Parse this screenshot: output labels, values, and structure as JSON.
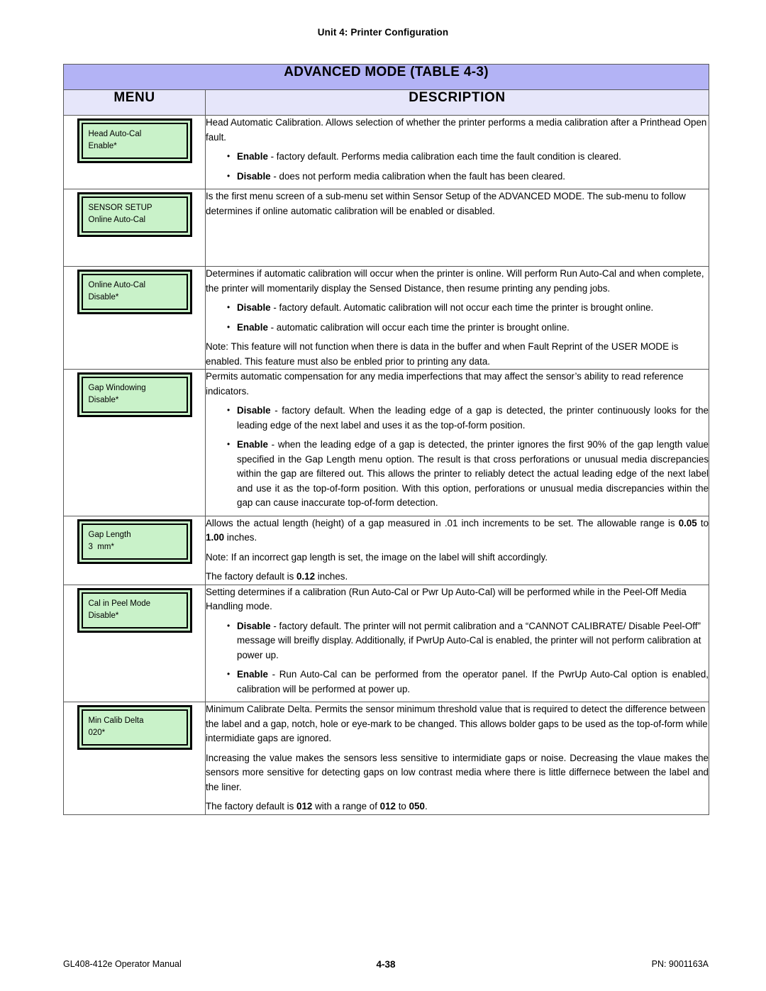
{
  "running_head": "Unit 4:  Printer Configuration",
  "table": {
    "title": "ADVANCED MODE (TABLE 4-3)",
    "col_menu_header": "MENU",
    "col_desc_header": "DESCRIPTION",
    "title_bg": "#b3b3f5",
    "header_bg": "#e6e6fa",
    "lcd_bg": "#c9f2c9",
    "rows": [
      {
        "lcd_line1": "Head Auto-Cal",
        "lcd_line2": "Enable*",
        "p1": "Head Automatic Calibration. Allows selection of whether the printer performs a media calibration after a Printhead Open fault.",
        "b1_label": "Enable",
        "b1_text": " - factory default. Performs media calibration each time the fault condition is cleared.",
        "b2_label": "Disable",
        "b2_text": " - does not perform media calibration when the fault has been cleared."
      },
      {
        "lcd_line1": "SENSOR SETUP",
        "lcd_line2": "Online Auto-Cal",
        "p1": "Is the first menu screen of a sub-menu set within Sensor Setup of the ADVANCED MODE. The sub-menu to follow determines if online automatic calibration will be enabled or disabled."
      },
      {
        "lcd_line1": "Online Auto-Cal",
        "lcd_line2": "Disable*",
        "p1": "Determines if automatic calibration will occur when the printer is online. Will perform Run Auto-Cal and when complete, the printer will momentarily display the Sensed Distance, then resume printing any pending jobs.",
        "b1_label": "Disable",
        "b1_text": " - factory default. Automatic calibration will not occur each time the printer is brought online.",
        "b2_label": "Enable",
        "b2_text": " - automatic calibration will occur each time the printer is brought online.",
        "p2": "Note: This feature will not function when there is data in the buffer and when Fault Reprint of the USER MODE is enabled. This feature must also be enbled prior to printing any data."
      },
      {
        "lcd_line1": "Gap Windowing",
        "lcd_line2": "Disable*",
        "p1": "Permits automatic compensation for any media imperfections that may affect the sensor’s ability to read reference indicators.",
        "b1_label": "Disable",
        "b1_text": " - factory default. When the leading edge of a gap is detected, the printer continuously looks for the leading edge of the next label and uses it as the top-of-form position.",
        "b2_label": "Enable",
        "b2_text": " - when the leading edge of a gap is detected, the printer ignores the first 90% of the gap length value specified in the Gap Length menu option. The result is that cross perforations or unusual media discrepancies within the gap are filtered out. This allows the printer to reliably detect the actual leading edge of the next label and use it as the top-of-form position. With this option, perforations or unusual media discrepancies within the gap can cause inaccurate top-of-form detection."
      },
      {
        "lcd_line1": "Gap Length",
        "lcd_line2": "3  mm*",
        "p1_a": "Allows the actual length (height) of a gap measured in .01 inch increments to be set. The allowable range is ",
        "p1_b1": "0.05",
        "p1_mid": " to ",
        "p1_b2": "1.00",
        "p1_c": " inches.",
        "p2": "Note: If an incorrect gap length is set, the image on the label will shift accordingly.",
        "p3_a": "The factory default is ",
        "p3_b": "0.12",
        "p3_c": " inches."
      },
      {
        "lcd_line1": "Cal in Peel Mode",
        "lcd_line2": "Disable*",
        "p1": "Setting determines if a calibration (Run Auto-Cal or Pwr Up Auto-Cal) will be performed while in the Peel-Off Media Handling mode.",
        "b1_label": "Disable",
        "b1_text": " - factory default. The printer will not permit calibration and a “CANNOT CALIBRATE/ Disable Peel-Off” message will breifly display. Additionally, if PwrUp Auto-Cal is enabled, the printer will not perform calibration at power up.",
        "b2_label": "Enable",
        "b2_text": " - Run Auto-Cal can be performed from the operator panel. If the PwrUp Auto-Cal option is enabled, calibration will be performed at power up."
      },
      {
        "lcd_line1": "Min Calib Delta",
        "lcd_line2": "020*",
        "p1": "Minimum Calibrate Delta. Permits the sensor minimum threshold value that is required to detect the difference  between the label and a gap, notch, hole or eye-mark to be changed. This allows bolder gaps to be used as the top-of-form while intermidiate gaps are ignored.",
        "p2": "Increasing the value makes the sensors less sensitive to intermidiate gaps or noise. Decreasing the vlaue makes the sensors more sensitive for  detecting gaps on low contrast media where there is little differnece between the label and the liner.",
        "p3_a": "The factory default is ",
        "p3_b1": "012",
        "p3_mid": " with a range of ",
        "p3_b2": "012",
        "p3_mid2": " to ",
        "p3_b3": "050",
        "p3_c": "."
      }
    ]
  },
  "footer": {
    "left": "GL408-412e Operator Manual",
    "center": "4-38",
    "right": "PN: 9001163A"
  }
}
